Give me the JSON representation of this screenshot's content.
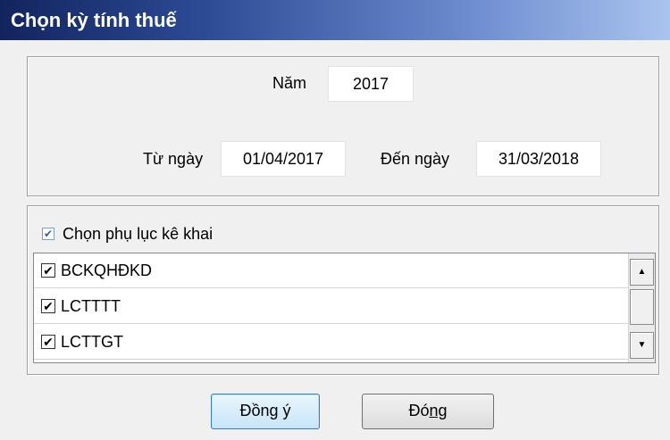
{
  "window": {
    "title": "Chọn kỳ tính thuế"
  },
  "period": {
    "year_label": "Năm",
    "year_value": "2017",
    "from_label": "Từ ngày",
    "from_value": "01/04/2017",
    "to_label": "Đến ngày",
    "to_value": "31/03/2018"
  },
  "appendix": {
    "select_all_label": "Chọn phụ lục kê khai",
    "select_all_checked": true,
    "items": [
      {
        "label": "BCKQHĐKD",
        "checked": true
      },
      {
        "label": "LCTTTT",
        "checked": true
      },
      {
        "label": "LCTTGT",
        "checked": true
      }
    ]
  },
  "buttons": {
    "ok_pre": "Đồn",
    "ok_u": "g",
    "ok_post": " ý",
    "close_pre": "Đó",
    "close_u": "ng"
  },
  "icons": {
    "check": "check-icon",
    "scroll_up": "arrow-up-icon",
    "scroll_down": "arrow-down-icon"
  },
  "colors": {
    "title_start": "#12245e",
    "title_end": "#a9c4ee",
    "primary_button": "#c7e5f8"
  }
}
